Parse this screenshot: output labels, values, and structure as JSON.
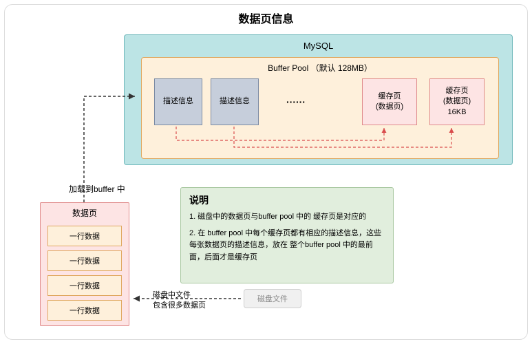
{
  "title": "数据页信息",
  "mysql": {
    "label": "MySQL",
    "bufferpool": {
      "label": "Buffer Pool （默认 128MB）",
      "desc1": "描述信息",
      "desc2": "描述信息",
      "dots": "······",
      "cache1": "缓存页\n(数据页)",
      "cache2": "缓存页\n(数据页)\n16KB"
    }
  },
  "load_label": "加载到buffer 中",
  "datapage": {
    "title": "数据页",
    "rows": [
      "一行数据",
      "一行数据",
      "一行数据",
      "一行数据"
    ]
  },
  "explain": {
    "title": "说明",
    "item1": "1. 磁盘中的数据页与buffer pool 中的 缓存页是对应的",
    "item2": "2. 在 buffer pool 中每个缓存页都有相应的描述信息，这些每张数据页的描述信息，放在 整个buffer pool 中的最前面，后面才是缓存页"
  },
  "disk": {
    "text": "磁盘中文件\n包含很多数据页",
    "file": "磁盘文件"
  }
}
